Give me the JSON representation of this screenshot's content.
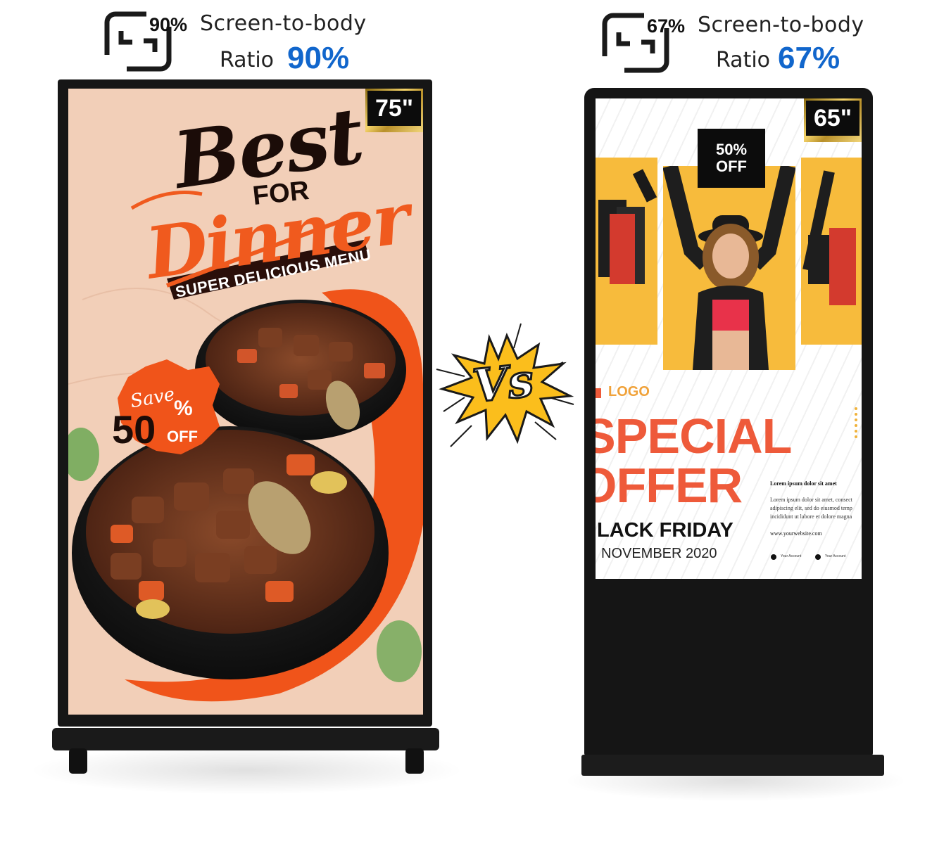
{
  "left": {
    "ratio_small": "90%",
    "screen_to_body": "Screen-to-body",
    "ratio_word": "Ratio",
    "ratio_big": "90%",
    "size_badge": "75\"",
    "poster": {
      "line1": "Best",
      "line2": "FOR",
      "line3": "Dinner",
      "banner": "SUPER DELICIOUS MENU",
      "save_word": "Save",
      "save_pct": "50",
      "save_pct_sign": "%",
      "save_off": "OFF"
    }
  },
  "vs_label": "Vs",
  "right": {
    "ratio_small": "67%",
    "screen_to_body": "Screen-to-body",
    "ratio_word": "Ratio",
    "ratio_big": "67%",
    "size_badge": "65\"",
    "poster": {
      "discount_top": "50%",
      "discount_bottom": "OFF",
      "logo": "LOGO",
      "special": "SPECIAL",
      "offer": "OFFER",
      "black_friday": "LACK FRIDAY",
      "date": "NOVEMBER 2020",
      "lorem_title": "Lorem ipsum dolor sit amet",
      "lorem_body_1": "Lorem ipsum dolor sit amet, consect",
      "lorem_body_2": "adipiscing elit, sed do eiusmod temp",
      "lorem_body_3": "incididunt ut labore et dolore magna",
      "website": "www.yourwebsite.com",
      "account_1": "Your Account",
      "account_2": "Your Account"
    }
  },
  "colors": {
    "accent_blue": "#1166cc",
    "poster_orange": "#f0541a",
    "poster_yellow": "#f7b733",
    "special_red": "#ee5a3a",
    "kiosk_black": "#151515"
  }
}
